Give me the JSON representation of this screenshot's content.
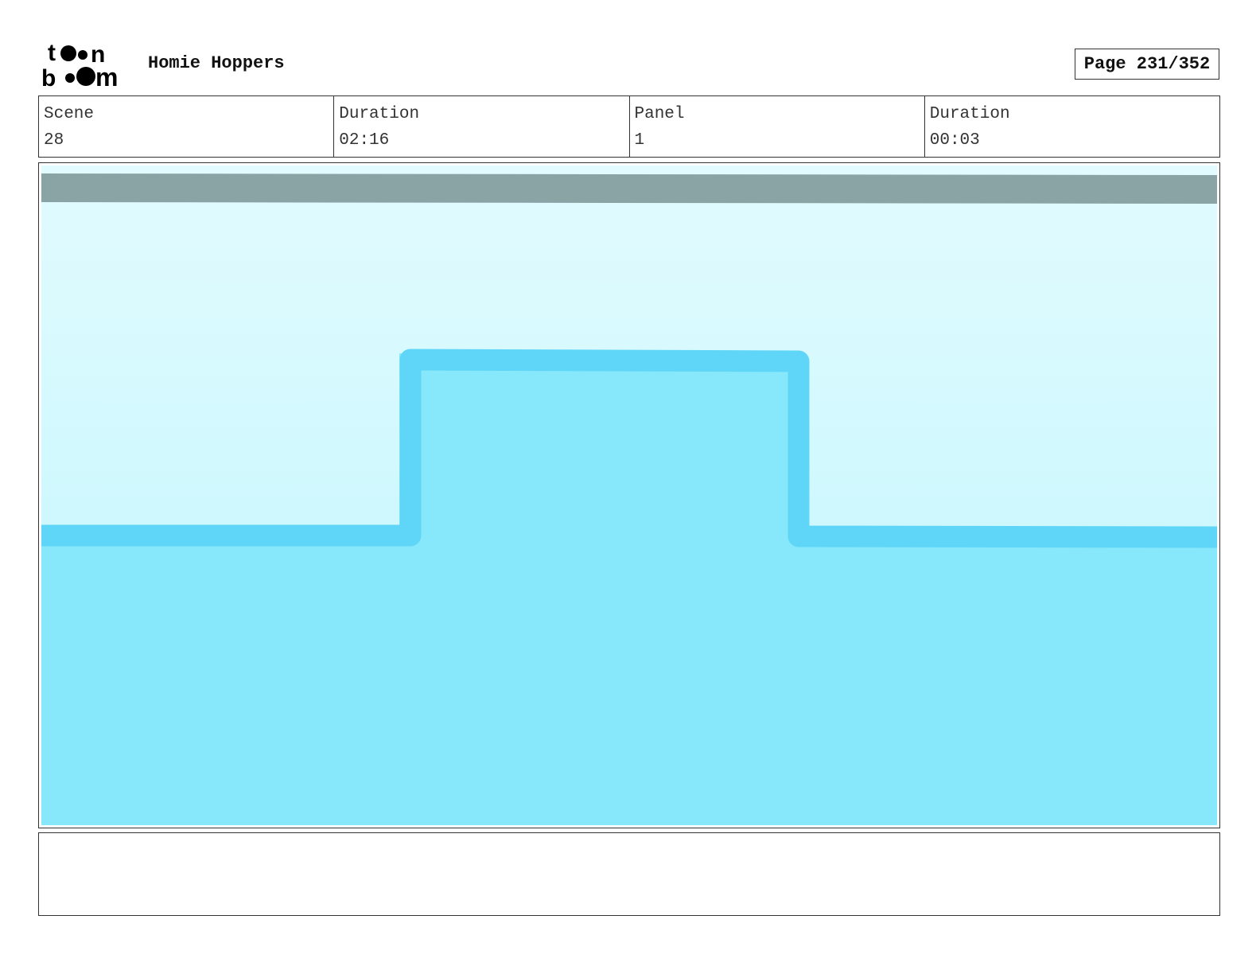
{
  "header": {
    "logo_text": "toon boom",
    "project_title": "Homie Hoppers",
    "page_label": "Page 231/352"
  },
  "info": [
    {
      "label": "Scene",
      "value": "28"
    },
    {
      "label": "Duration",
      "value": "02:16"
    },
    {
      "label": "Panel",
      "value": "1"
    },
    {
      "label": "Duration",
      "value": "00:03"
    }
  ],
  "panel": {
    "colors": {
      "sky_top": "#e2fbff",
      "sky_bottom": "#bdf6fc",
      "ground": "#87e8fb",
      "outline": "#5fd6f7",
      "top_bar": "#8aa4a6"
    }
  },
  "notes": {
    "text": ""
  }
}
